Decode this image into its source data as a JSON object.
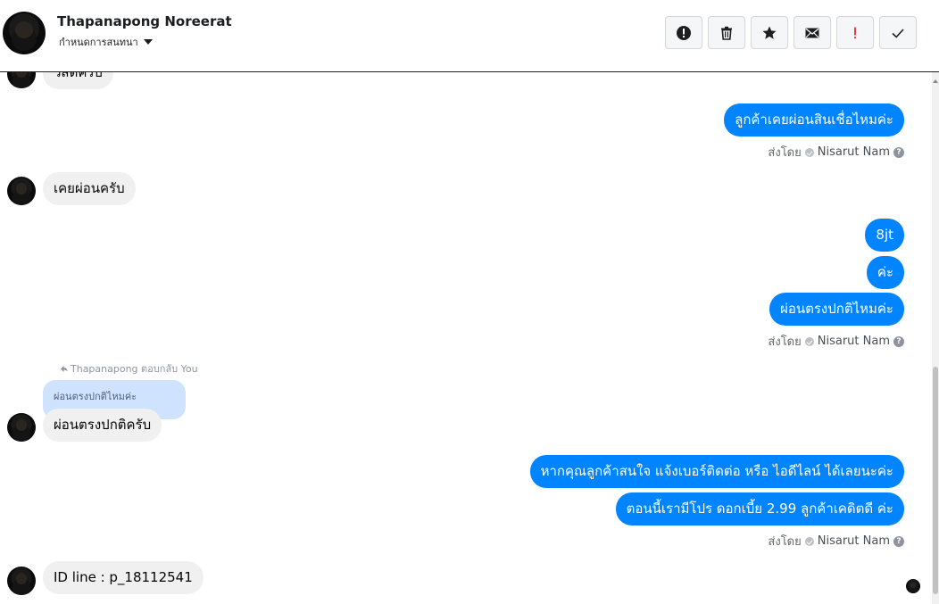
{
  "header": {
    "name": "Thapanapong Noreerat",
    "subtitle": "กำหนดการสนทนา",
    "actions": [
      {
        "name": "report-button",
        "icon": "alert-circle-icon"
      },
      {
        "name": "delete-button",
        "icon": "trash-icon"
      },
      {
        "name": "star-button",
        "icon": "star-icon"
      },
      {
        "name": "mark-unread-button",
        "icon": "envelope-icon"
      },
      {
        "name": "important-button",
        "icon": "exclamation-icon"
      },
      {
        "name": "done-button",
        "icon": "check-icon"
      }
    ]
  },
  "messages": {
    "m0": "วัสดีครับ",
    "m1": "ลูกค้าเคยผ่อนสินเชื่อไหมค่ะ",
    "m2": "เคยผ่อนครับ",
    "m3": "8jt",
    "m4": "ค่ะ",
    "m5": "ผ่อนตรงปกติไหมค่ะ",
    "reply_meta": "Thapanapong ตอบกลับ You",
    "reply_quote": "ผ่อนตรงปกติไหมค่ะ",
    "m6": "ผ่อนตรงปกติครับ",
    "m7": "หากคุณลูกค้าสนใจ แจ้งเบอร์ติดต่อ หรือ ไอดีไลน์ ได้เลยนะค่ะ",
    "m8": "ตอนนี้เรามีโปร ดอกเบี้ย 2.99 ลูกค้าเคดิตดี ค่ะ",
    "m9": "ID line : p_18112541"
  },
  "sent_by": {
    "label": "ส่งโดย",
    "agent": "Nisarut Nam",
    "help": "?"
  },
  "colors": {
    "outgoing": "#0084ff",
    "incoming": "#f0f0f0",
    "reply_quote": "#cfe3ff"
  }
}
